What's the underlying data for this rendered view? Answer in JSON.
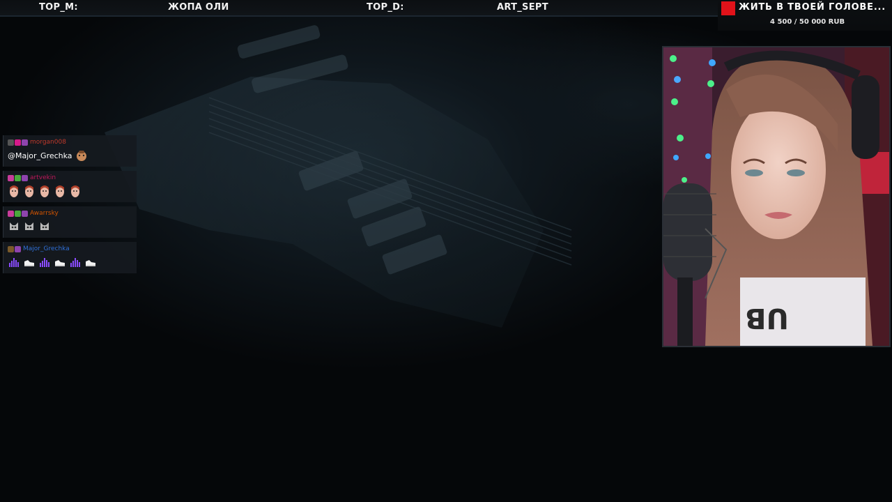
{
  "topbar": {
    "top_m_label": "TOP_M:",
    "top_m_value": "ЖОПА ОЛИ",
    "top_d_label": "TOP_D:",
    "top_d_value": "ART_SEPT"
  },
  "goal": {
    "title": "ЖИТЬ В ТВОЕЙ ГОЛОВЕ...",
    "amount": "4 500 / 50 000 RUB",
    "progress_fraction": 0.09,
    "accent": "#e1121a"
  },
  "chat": {
    "messages": [
      {
        "username": "morgan008",
        "username_color": "#c0392b",
        "badges": [
          "hourglass-badge",
          "heart-badge",
          "star-badge"
        ],
        "text": "@Major_Grechka",
        "emotes": [
          "face-emote"
        ]
      },
      {
        "username": "artvekin",
        "username_color": "#c2185b",
        "badges": [
          "sword-badge",
          "check-badge",
          "star-badge"
        ],
        "text": "",
        "emotes": [
          "face-emote",
          "face-emote",
          "face-emote",
          "face-emote",
          "face-emote"
        ]
      },
      {
        "username": "Awarrsky",
        "username_color": "#d35400",
        "badges": [
          "sword-badge",
          "check-badge",
          "star-badge"
        ],
        "text": "",
        "emotes": [
          "cat-emote",
          "cat-emote",
          "cat-emote"
        ]
      },
      {
        "username": "Major_Grechka",
        "username_color": "#2f6fd6",
        "badges": [
          "hourglass-badge",
          "star-badge"
        ],
        "text": "",
        "emotes": [
          "equalizer-emote",
          "sneaker-emote",
          "equalizer-emote",
          "sneaker-emote",
          "equalizer-emote",
          "sneaker-emote"
        ]
      }
    ]
  }
}
